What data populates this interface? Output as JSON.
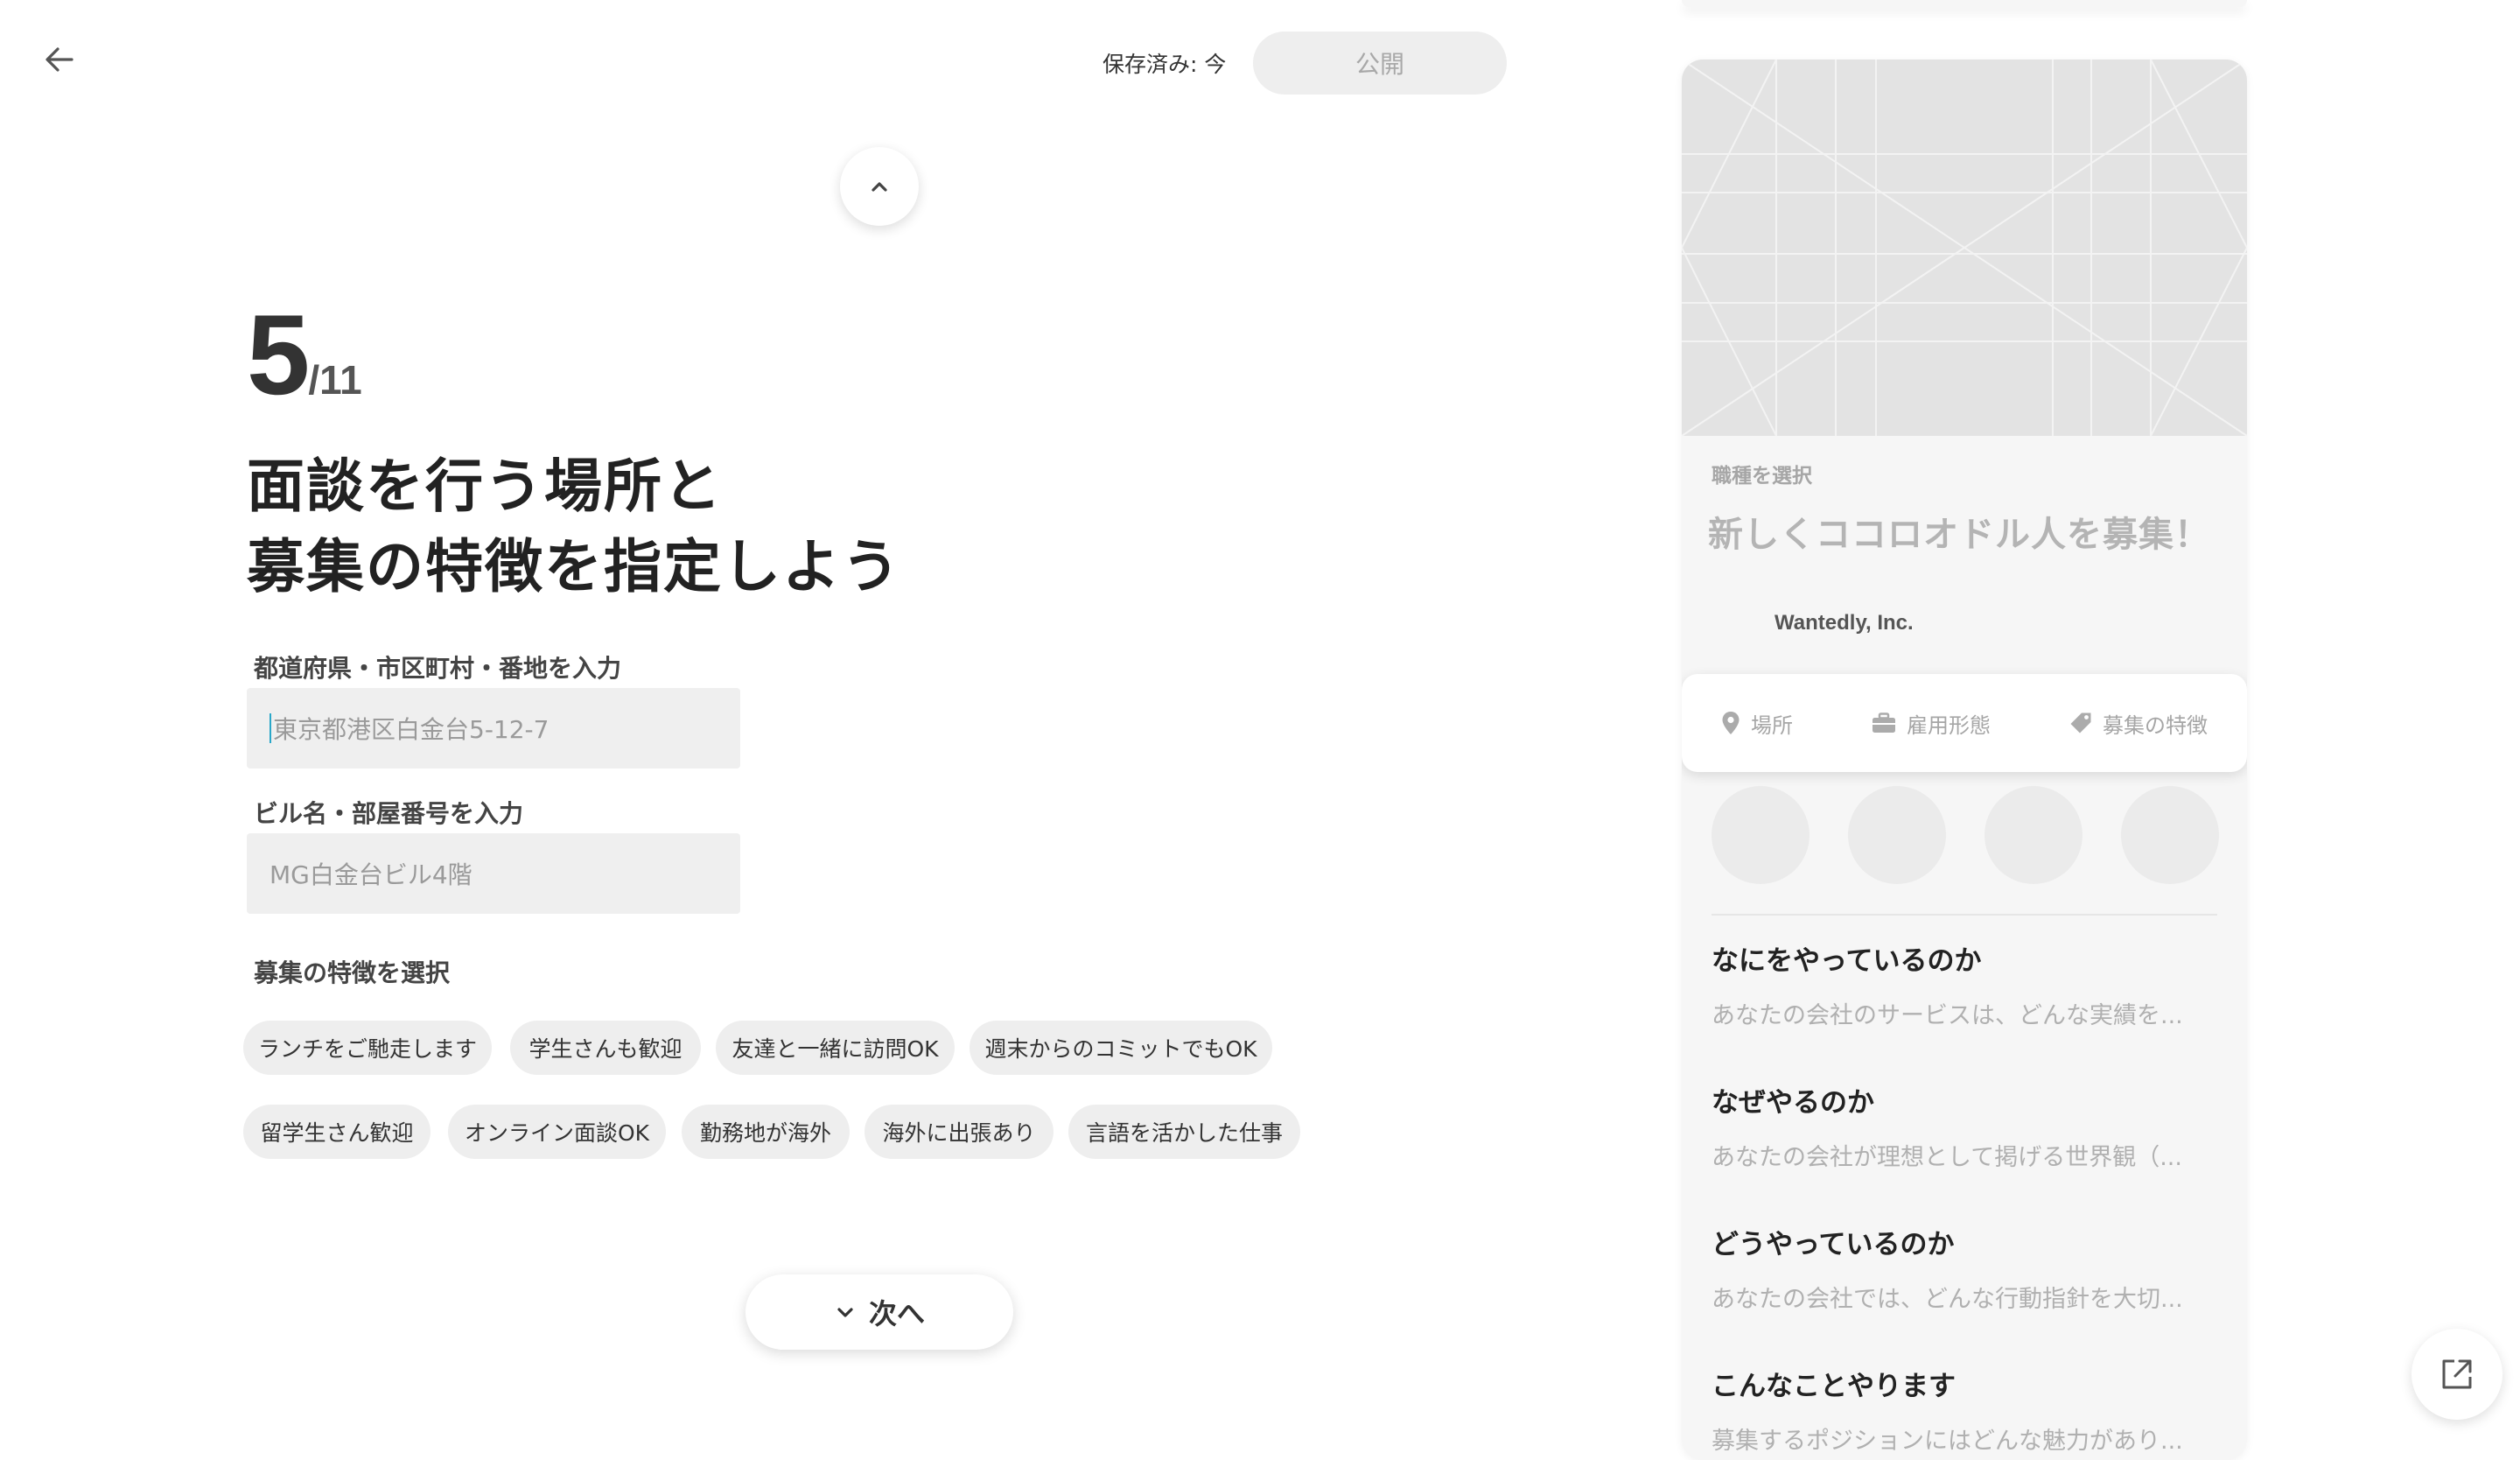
{
  "header": {
    "saved_status": "保存済み: 今",
    "publish_label": "公開"
  },
  "step": {
    "current": "5",
    "total": "/11"
  },
  "headline": {
    "line1": "面談を行う場所と",
    "line2": "募集の特徴を指定しよう"
  },
  "address": {
    "label": "都道府県・市区町村・番地を入力",
    "placeholder": "東京都港区白金台5-12-7"
  },
  "building": {
    "label": "ビル名・部屋番号を入力",
    "placeholder": "MG白金台ビル4階"
  },
  "features": {
    "label": "募集の特徴を選択",
    "chips": [
      "ランチをご馳走します",
      "学生さんも歓迎",
      "友達と一緒に訪問OK",
      "週末からのコミットでもOK",
      "留学生さん歓迎",
      "オンライン面談OK",
      "勤務地が海外",
      "海外に出張あり",
      "言語を活かした仕事"
    ]
  },
  "next_label": "次へ",
  "preview": {
    "category": "職種を選択",
    "title": "新しくココロオドル人を募集！",
    "company": "Wantedly, Inc.",
    "tabs": [
      {
        "icon": "location-pin-icon",
        "label": "場所"
      },
      {
        "icon": "briefcase-icon",
        "label": "雇用形態"
      },
      {
        "icon": "tag-icon",
        "label": "募集の特徴"
      }
    ],
    "sections": [
      {
        "heading": "なにをやっているのか",
        "text": "あなたの会社のサービスは、どんな実績を..."
      },
      {
        "heading": "なぜやるのか",
        "text": "あなたの会社が理想として掲げる世界観（..."
      },
      {
        "heading": "どうやっているのか",
        "text": "あなたの会社では、どんな行動指針を大切..."
      },
      {
        "heading": "こんなことやります",
        "text": "募集するポジションにはどんな魅力があり..."
      }
    ]
  },
  "colors": {
    "accent_caret": "#2aa7c9",
    "chip_bg": "#eeeeee",
    "input_bg": "#efefef"
  }
}
